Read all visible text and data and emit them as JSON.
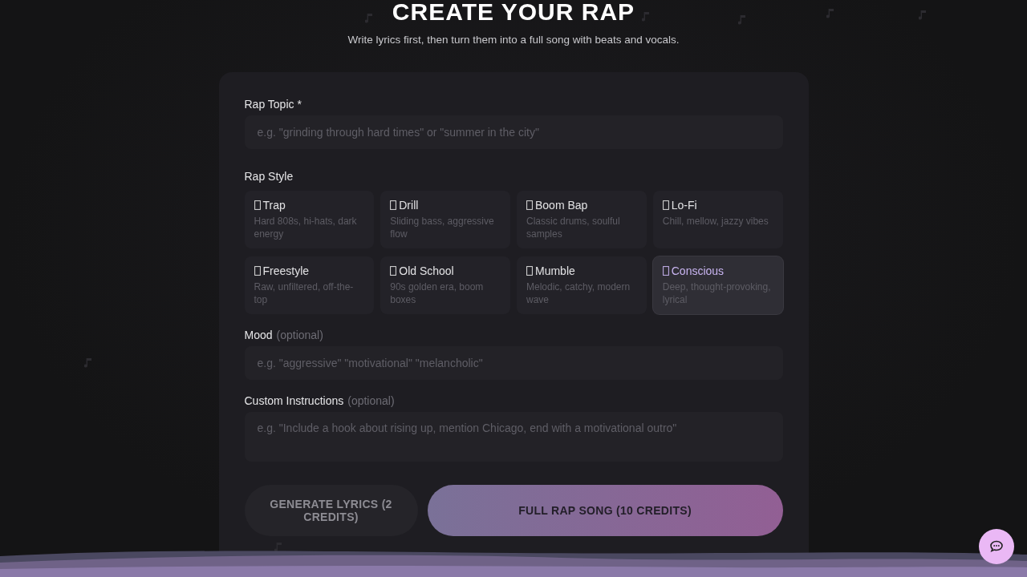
{
  "header": {
    "title": "CREATE YOUR RAP",
    "subtitle": "Write lyrics first, then turn them into a full song with beats and vocals."
  },
  "topic": {
    "label": "Rap Topic *",
    "placeholder": "e.g. \"grinding through hard times\" or \"summer in the city\""
  },
  "style": {
    "label": "Rap Style",
    "options": [
      {
        "name": "Trap",
        "description": "Hard 808s, hi-hats, dark energy",
        "selected": false
      },
      {
        "name": "Drill",
        "description": "Sliding bass, aggressive flow",
        "selected": false
      },
      {
        "name": "Boom Bap",
        "description": "Classic drums, soulful samples",
        "selected": false
      },
      {
        "name": "Lo-Fi",
        "description": "Chill, mellow, jazzy vibes",
        "selected": false
      },
      {
        "name": "Freestyle",
        "description": "Raw, unfiltered, off-the-top",
        "selected": false
      },
      {
        "name": "Old School",
        "description": "90s golden era, boom boxes",
        "selected": false
      },
      {
        "name": "Mumble",
        "description": "Melodic, catchy, modern wave",
        "selected": false
      },
      {
        "name": "Conscious",
        "description": "Deep, thought-provoking, lyrical",
        "selected": true
      }
    ]
  },
  "mood": {
    "label": "Mood",
    "hint": "(optional)",
    "placeholder": "e.g. \"aggressive\" \"motivational\" \"melancholic\""
  },
  "instructions": {
    "label": "Custom Instructions",
    "hint": "(optional)",
    "placeholder": "e.g. \"Include a hook about rising up, mention Chicago, end with a motivational outro\""
  },
  "buttons": [
    {
      "label": "GENERATE LYRICS (2 CREDITS)",
      "kind": "secondary"
    },
    {
      "label": "FULL RAP SONG (10 CREDITS)",
      "kind": "primary"
    }
  ]
}
